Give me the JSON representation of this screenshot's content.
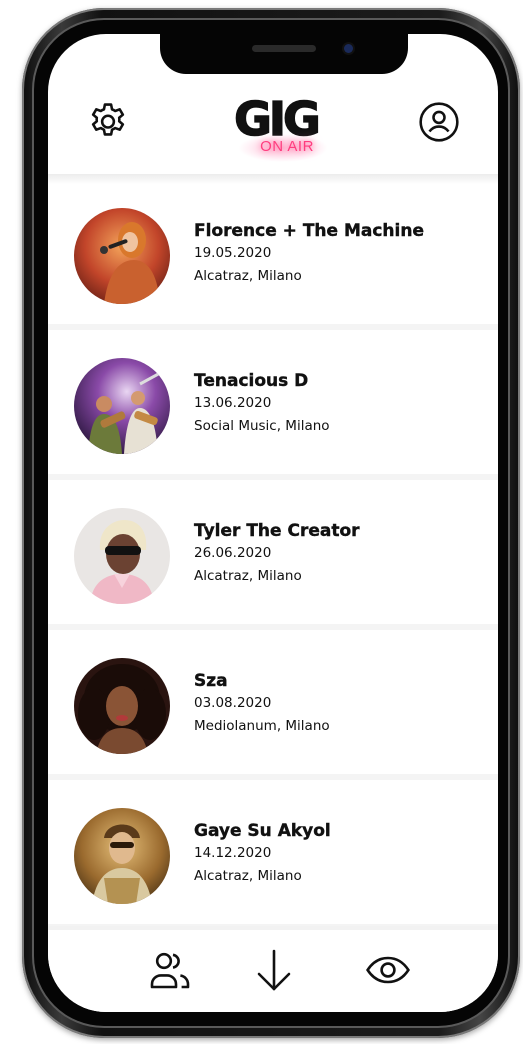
{
  "app": {
    "logo_main": "GIG",
    "logo_sub": "ON AIR",
    "accent_color": "#ff3d7f"
  },
  "header": {
    "settings_icon": "gear-icon",
    "profile_icon": "user-circle-icon"
  },
  "events": [
    {
      "name": "Florence + The Machine",
      "date": "19.05.2020",
      "venue": "Alcatraz, Milano"
    },
    {
      "name": "Tenacious D",
      "date": "13.06.2020",
      "venue": "Social Music, Milano"
    },
    {
      "name": "Tyler The Creator",
      "date": "26.06.2020",
      "venue": "Alcatraz, Milano"
    },
    {
      "name": "Sza",
      "date": "03.08.2020",
      "venue": "Mediolanum, Milano"
    },
    {
      "name": "Gaye Su Akyol",
      "date": "14.12.2020",
      "venue": "Alcatraz, Milano"
    }
  ],
  "bottom_nav": {
    "items": [
      {
        "icon": "users-icon"
      },
      {
        "icon": "arrow-down-icon"
      },
      {
        "icon": "eye-icon"
      }
    ]
  }
}
